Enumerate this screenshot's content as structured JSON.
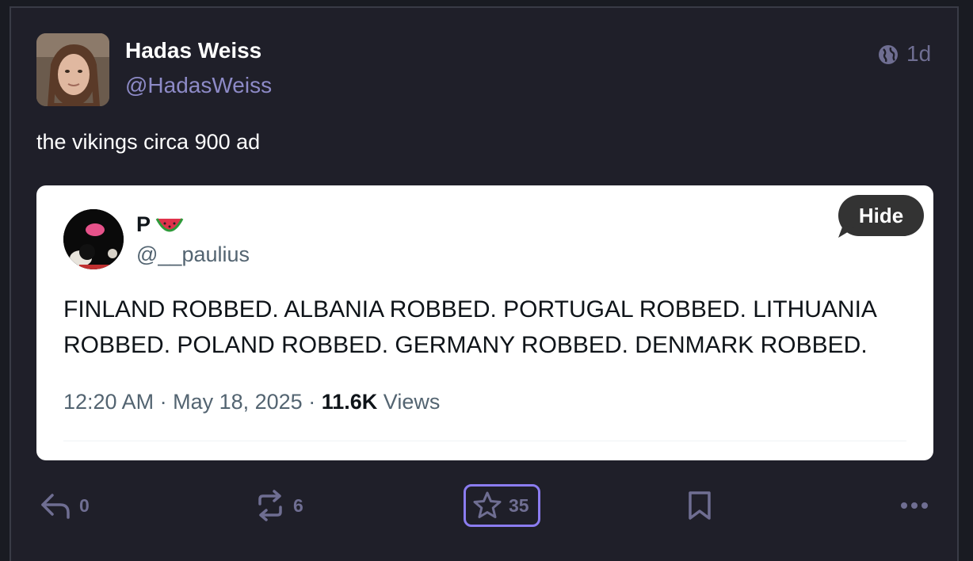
{
  "post": {
    "author_name": "Hadas Weiss",
    "author_handle": "@HadasWeiss",
    "time": "1d",
    "visibility_icon": "globe-icon",
    "text": "the vikings circa 900 ad"
  },
  "embed": {
    "name": "P",
    "emoji": "watermelon-icon",
    "handle": "@__paulius",
    "hide_label": "Hide",
    "text": "FINLAND ROBBED. ALBANIA ROBBED. PORTUGAL ROBBED. LITHUANIA ROBBED. POLAND ROBBED. GERMANY ROBBED. DENMARK ROBBED.",
    "time": "12:20 AM",
    "date": "May 18, 2025",
    "views_count": "11.6K",
    "views_label": "Views"
  },
  "actions": {
    "reply_count": "0",
    "repost_count": "6",
    "like_count": "35",
    "accent": "#8b7cf0"
  }
}
